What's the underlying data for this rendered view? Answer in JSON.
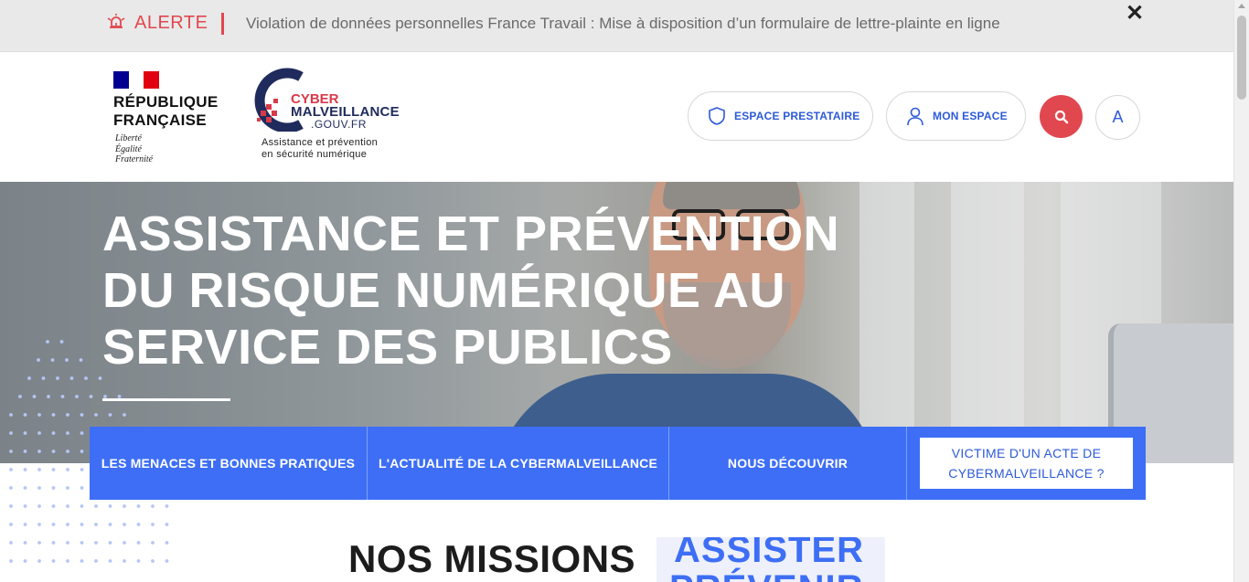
{
  "alert": {
    "label": "ALERTE",
    "message": "Violation de données personnelles France Travail : Mise à disposition d’un formulaire de lettre-plainte en ligne",
    "close_symbol": "✕",
    "bell_icon": "bell-alert-icon",
    "accent_color": "#e1474f"
  },
  "header": {
    "republique": {
      "name_line1": "RÉPUBLIQUE",
      "name_line2": "FRANÇAISE",
      "motto1": "Liberté",
      "motto2": "Égalité",
      "motto3": "Fraternité"
    },
    "cyber_logo": {
      "word1": "CYBER",
      "word2": "MALVEILLANCE",
      "word3": ".GOUV.FR",
      "tagline1": "Assistance et prévention",
      "tagline2": "en sécurité numérique"
    },
    "buttons": {
      "prestataire": "ESPACE PRESTATAIRE",
      "mon_espace": "MON ESPACE",
      "accessibility": "A"
    },
    "icons": {
      "prestataire": "shield-icon",
      "mon_espace": "user-icon",
      "search": "search-icon"
    }
  },
  "hero": {
    "title_line1": "ASSISTANCE ET PRÉVENTION",
    "title_line2": "DU RISQUE NUMÉRIQUE AU",
    "title_line3": "SERVICE DES PUBLICS"
  },
  "nav": {
    "items": [
      {
        "label": "LES MENACES ET BONNES PRATIQUES"
      },
      {
        "label": "L'ACTUALITÉ DE LA CYBERMALVEILLANCE"
      },
      {
        "label": "NOUS DÉCOUVRIR"
      }
    ],
    "victim_line1": "VICTIME D'UN ACTE DE",
    "victim_line2": "CYBERMALVEILLANCE ?"
  },
  "missions": {
    "title": "NOS MISSIONS",
    "word1": "ASSISTER",
    "word2": "PRÉVENIR"
  },
  "colors": {
    "brand_blue": "#3d6ef5",
    "brand_red": "#e1474f",
    "navy": "#1f2b5c"
  }
}
